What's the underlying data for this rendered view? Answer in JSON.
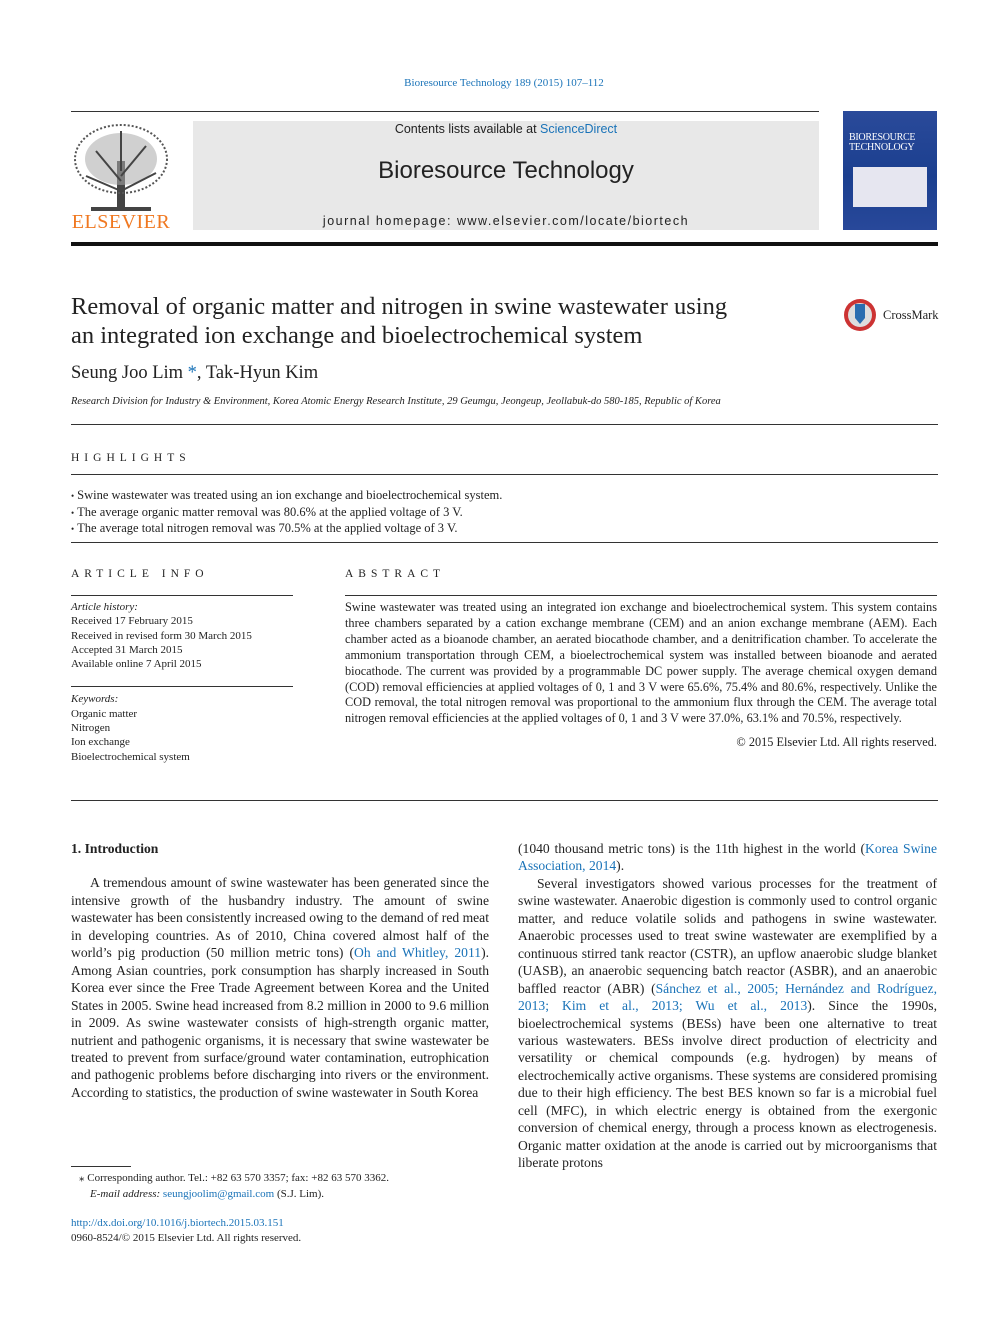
{
  "journal_ref": "Bioresource Technology 189 (2015) 107–112",
  "header": {
    "contents_prefix": "Contents lists available at ",
    "contents_link": "ScienceDirect",
    "journal_title": "Bioresource Technology",
    "homepage": "journal homepage: www.elsevier.com/locate/biortech",
    "publisher_logo": "ELSEVIER",
    "cover_title": "BIORESOURCE TECHNOLOGY",
    "crossmark": "CrossMark"
  },
  "article": {
    "title_line1": "Removal of organic matter and nitrogen in swine wastewater using",
    "title_line2": "an integrated ion exchange and bioelectrochemical system",
    "author1": "Seung Joo Lim",
    "author1_mark": " *",
    ",sep": ", ",
    "author2": "Tak-Hyun Kim",
    "affiliation": "Research Division for Industry & Environment, Korea Atomic Energy Research Institute, 29 Geumgu, Jeongeup, Jeollabuk-do 580-185, Republic of Korea"
  },
  "highlights": {
    "heading": "HIGHLIGHTS",
    "items": [
      "Swine wastewater was treated using an ion exchange and bioelectrochemical system.",
      "The average organic matter removal was 80.6% at the applied voltage of 3 V.",
      "The average total nitrogen removal was 70.5% at the applied voltage of 3 V."
    ]
  },
  "article_info": {
    "heading": "ARTICLE INFO",
    "history_label": "Article history:",
    "history": [
      "Received 17 February 2015",
      "Received in revised form 30 March 2015",
      "Accepted 31 March 2015",
      "Available online 7 April 2015"
    ],
    "keywords_label": "Keywords:",
    "keywords": [
      "Organic matter",
      "Nitrogen",
      "Ion exchange",
      "Bioelectrochemical system"
    ]
  },
  "abstract": {
    "heading": "ABSTRACT",
    "text": "Swine wastewater was treated using an integrated ion exchange and bioelectrochemical system. This sys­tem contains three chambers separated by a cation exchange membrane (CEM) and an anion exchange membrane (AEM). Each chamber acted as a bioanode chamber, an aerated biocathode chamber, and a denitrification chamber. To accelerate the ammonium transportation through CEM, a bioelectrochemical system was installed between bioanode and aerated biocathode. The current was provided by a pro­grammable DC power supply. The average chemical oxygen demand (COD) removal efficiencies at applied voltages of 0, 1 and 3 V were 65.6%, 75.4% and 80.6%, respectively. Unlike the COD removal, the total nitrogen removal was proportional to the ammonium flux through the CEM. The average total nitrogen removal efficiencies at the applied voltages of 0, 1 and 3 V were 37.0%, 63.1% and 70.5%, respectively.",
    "copyright": "© 2015 Elsevier Ltd. All rights reserved."
  },
  "intro": {
    "heading": "1. Introduction",
    "p1a": "A tremendous amount of swine wastewater has been generated since the intensive growth of the husbandry industry. The amount of swine wastewater has been consistently increased owing to the demand of red meat in developing countries. As of 2010, China cov­ered almost half of the world’s pig production (50 million metric tons) (",
    "p1ref": "Oh and Whitley, 2011",
    "p1b": "). Among Asian countries, pork con­sumption has sharply increased in South Korea ever since the Free Trade Agreement between Korea and the United States in 2005. Swine head increased from 8.2 million in 2000 to 9.6 million in 2009. As swine wastewater consists of high-strength organic matter, nutrient and pathogenic organisms, it is necessary that swine wastewater be treated to prevent from surface/ground water contamination, eutrophication and pathogenic problems before discharging into rivers or the environment. According to statistics, the production of swine wastewater in South Korea",
    "p1c": "(1040 thousand metric tons) is the 11th highest in the world (",
    "p1cref": "Korea Swine Association, 2014",
    "p1d": ").",
    "p2a": "Several investigators showed various processes for the treat­ment of swine wastewater. Anaerobic digestion is commonly used to control organic matter, and reduce volatile solids and pathogens in swine wastewater. Anaerobic processes used to treat swine wastewater are exemplified by a continuous stirred tank reactor (CSTR), an upflow anaerobic sludge blanket (UASB), an anaerobic sequencing batch reactor (ASBR), and an anaerobic baffled reactor (ABR) (",
    "p2ref": "Sánchez et al., 2005; Hernández and Rodríguez, 2013; Kim et al., 2013; Wu et al., 2013",
    "p2b": "). Since the 1990s, bioelectrochemical systems (BESs) have been one alternative to treat various wastewaters. BESs involve direct production of electricity and versatility or chemical compounds (e.g. hydrogen) by means of electrochemically active organisms. These systems are considered promising due to their high efficiency. The best BES known so far is a microbial fuel cell (MFC), in which electric energy is obtained from the exergonic conversion of chemical energy, through a pro­cess known as electrogenesis. Organic matter oxidation at the anode is carried out by microorganisms that liberate protons"
  },
  "footnote": {
    "mark": "⁎",
    "text": " Corresponding author. Tel.: +82 63 570 3357; fax: +82 63 570 3362.",
    "email_label": "E-mail address: ",
    "email": "seungjoolim@gmail.com",
    "email_suffix": " (S.J. Lim)."
  },
  "doi": "http://dx.doi.org/10.1016/j.biortech.2015.03.151",
  "issn": "0960-8524/© 2015 Elsevier Ltd. All rights reserved."
}
